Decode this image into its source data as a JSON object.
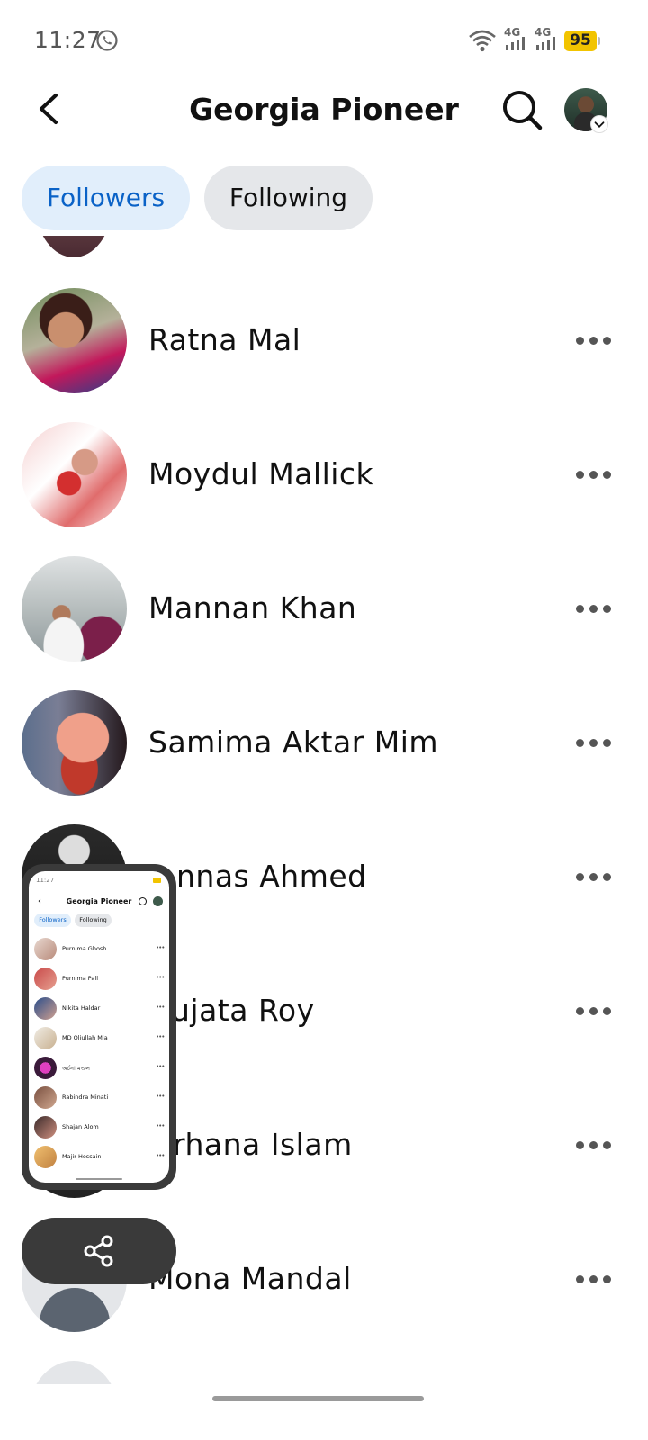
{
  "status_bar": {
    "time": "11:27",
    "network_1": "4G",
    "network_2": "4G",
    "battery": "95"
  },
  "header": {
    "title": "Georgia Pioneer",
    "back_icon": "back-arrow-icon",
    "search_icon": "search-icon"
  },
  "tabs": {
    "followers_label": "Followers",
    "following_label": "Following",
    "active": "Followers"
  },
  "followers": [
    {
      "name": "Ratna Mal"
    },
    {
      "name": "Moydul Mallick"
    },
    {
      "name": "Mannan Khan"
    },
    {
      "name": "Samima Aktar Mim"
    },
    {
      "name": "nnas Ahmed"
    },
    {
      "name": "ujata Roy"
    },
    {
      "name": "rhana Islam"
    },
    {
      "name": "Mona Mandal"
    }
  ],
  "mini_window": {
    "time": "11:27",
    "title": "Georgia Pioneer",
    "tab_followers": "Followers",
    "tab_following": "Following",
    "rows": [
      {
        "name": "Purnima Ghosh"
      },
      {
        "name": "Purnima Pall"
      },
      {
        "name": "Nikita Haldar"
      },
      {
        "name": "MD Oliullah Mia"
      },
      {
        "name": "অর্চনা মণ্ডল"
      },
      {
        "name": "Rabindra Minati"
      },
      {
        "name": "Shajan Alom"
      },
      {
        "name": "Majir Hossain"
      }
    ]
  },
  "colors": {
    "accent": "#0a62c7",
    "active_tab_bg": "#e1eefb",
    "inactive_tab_bg": "#e5e7ea",
    "battery": "#f2c400"
  }
}
